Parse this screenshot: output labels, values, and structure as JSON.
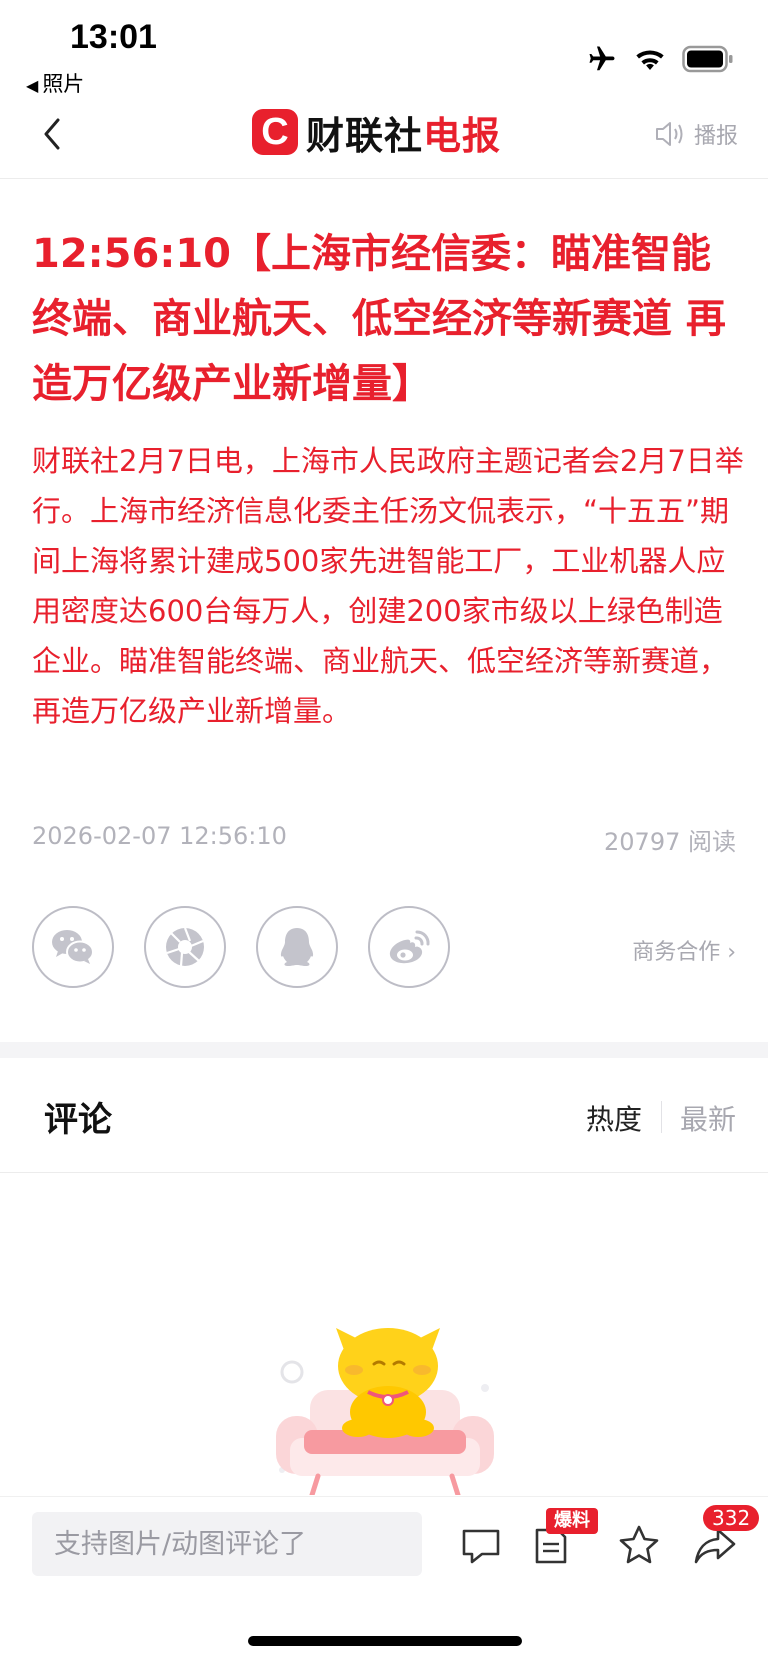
{
  "status_bar": {
    "time": "13:01",
    "back_app": "照片"
  },
  "nav": {
    "logo_mark": "C",
    "logo_text_black": "财联社",
    "logo_text_red": "电报",
    "broadcast_label": "播报"
  },
  "article": {
    "headline": "12:56:10【上海市经信委：瞄准智能终端、商业航天、低空经济等新赛道 再造万亿级产业新增量】",
    "body": "财联社2月7日电，上海市人民政府主题记者会2月7日举行。上海市经济信息化委主任汤文侃表示，“十五五”期间上海将累计建成500家先进智能工厂，工业机器人应用密度达600台每万人，创建200家市级以上绿色制造企业。瞄准智能终端、商业航天、低空经济等新赛道，再造万亿级产业新增量。",
    "datetime": "2026-02-07 12:56:10",
    "reads": "20797 阅读"
  },
  "share": {
    "items": [
      "wechat-icon",
      "moments-icon",
      "qq-icon",
      "weibo-icon"
    ],
    "business_label": "商务合作 ›"
  },
  "comments": {
    "title": "评论",
    "sort_hot": "热度",
    "sort_new": "最新"
  },
  "bottom_bar": {
    "input_placeholder": "支持图片/动图评论了",
    "tip_badge": "爆料",
    "share_count": "332"
  },
  "colors": {
    "accent": "#e8202d",
    "muted": "#a8a8b0"
  }
}
